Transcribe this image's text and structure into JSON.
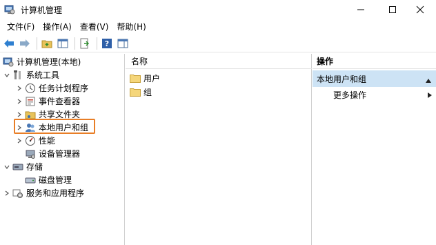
{
  "window": {
    "title": "计算机管理"
  },
  "menu": [
    "文件(F)",
    "操作(A)",
    "查看(V)",
    "帮助(H)"
  ],
  "tree": {
    "root": "计算机管理(本地)",
    "system_tools": "系统工具",
    "task_scheduler": "任务计划程序",
    "event_viewer": "事件查看器",
    "shared_folders": "共享文件夹",
    "local_users_groups": "本地用户和组",
    "performance": "性能",
    "device_manager": "设备管理器",
    "storage": "存储",
    "disk_management": "磁盘管理",
    "services_apps": "服务和应用程序"
  },
  "list": {
    "header": "名称",
    "items": [
      "用户",
      "组"
    ]
  },
  "actions": {
    "header": "操作",
    "section": "本地用户和组",
    "more": "更多操作"
  },
  "colors": {
    "selection_outline": "#e87e27",
    "action_section_bg": "#cde3f5",
    "folder": "#e8c35a"
  }
}
